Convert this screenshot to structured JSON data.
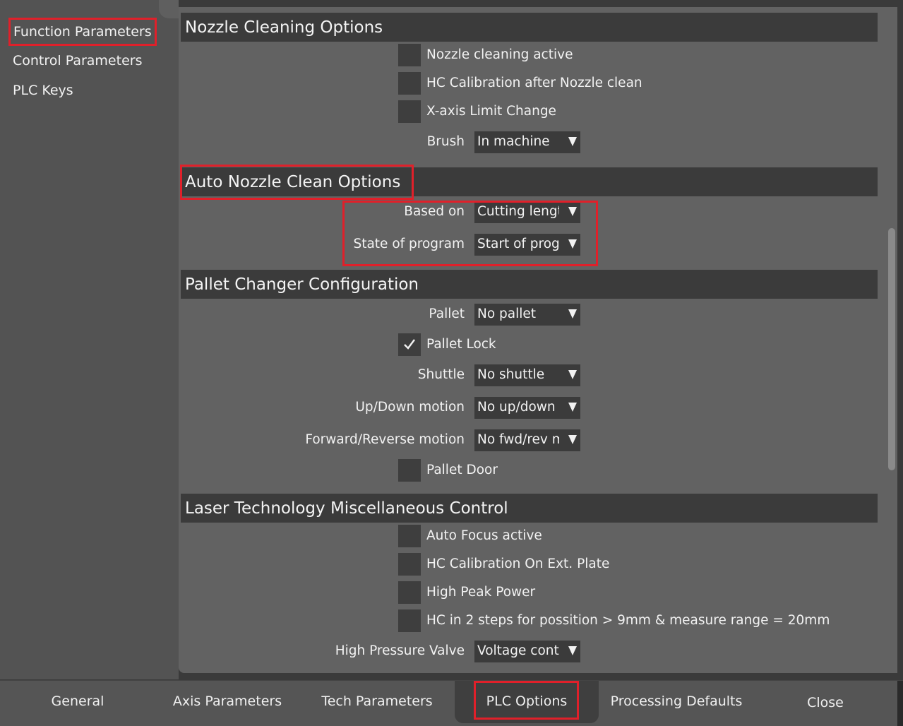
{
  "sidebar": {
    "items": [
      {
        "label": "Function Parameters",
        "active": true
      },
      {
        "label": "Control Parameters",
        "active": false
      },
      {
        "label": "PLC Keys",
        "active": false
      }
    ]
  },
  "sections": {
    "nozzle_cleaning": {
      "title": "Nozzle Cleaning Options",
      "nozzle_cleaning_active": {
        "label": "Nozzle cleaning active",
        "checked": false
      },
      "hc_calibration": {
        "label": "HC Calibration after Nozzle clean",
        "checked": false
      },
      "x_axis_limit": {
        "label": "X-axis Limit Change",
        "checked": false
      },
      "brush": {
        "label": "Brush",
        "value": "In machine"
      }
    },
    "auto_nozzle_clean": {
      "title": "Auto Nozzle Clean Options",
      "based_on": {
        "label": "Based on",
        "value": "Cutting length"
      },
      "state_of_program": {
        "label": "State of program",
        "value": "Start of program"
      }
    },
    "pallet_changer": {
      "title": "Pallet Changer Configuration",
      "pallet": {
        "label": "Pallet",
        "value": "No pallet"
      },
      "pallet_lock": {
        "label": "Pallet Lock",
        "checked": true
      },
      "shuttle": {
        "label": "Shuttle",
        "value": "No shuttle"
      },
      "up_down": {
        "label": "Up/Down motion",
        "value": "No up/down"
      },
      "fwd_rev": {
        "label": "Forward/Reverse motion",
        "value": "No fwd/rev motion"
      },
      "pallet_door": {
        "label": "Pallet Door",
        "checked": false
      }
    },
    "laser_misc": {
      "title": "Laser Technology Miscellaneous Control",
      "auto_focus": {
        "label": "Auto Focus active",
        "checked": false
      },
      "hc_ext_plate": {
        "label": "HC Calibration On Ext. Plate",
        "checked": false
      },
      "high_peak": {
        "label": "High Peak Power",
        "checked": false
      },
      "hc_two_steps": {
        "label": "HC in 2 steps for possition > 9mm & measure range = 20mm",
        "checked": false
      },
      "high_pressure_valve": {
        "label": "High Pressure Valve",
        "value": "Voltage control"
      }
    }
  },
  "bottom_tabs": {
    "general": "General",
    "axis": "Axis Parameters",
    "tech": "Tech Parameters",
    "plc": "PLC Options",
    "processing": "Processing Defaults",
    "close": "Close"
  },
  "colors": {
    "highlight": "#e0202a",
    "panel": "#626262",
    "header": "#3b3b3b",
    "sidebar": "#535353"
  }
}
